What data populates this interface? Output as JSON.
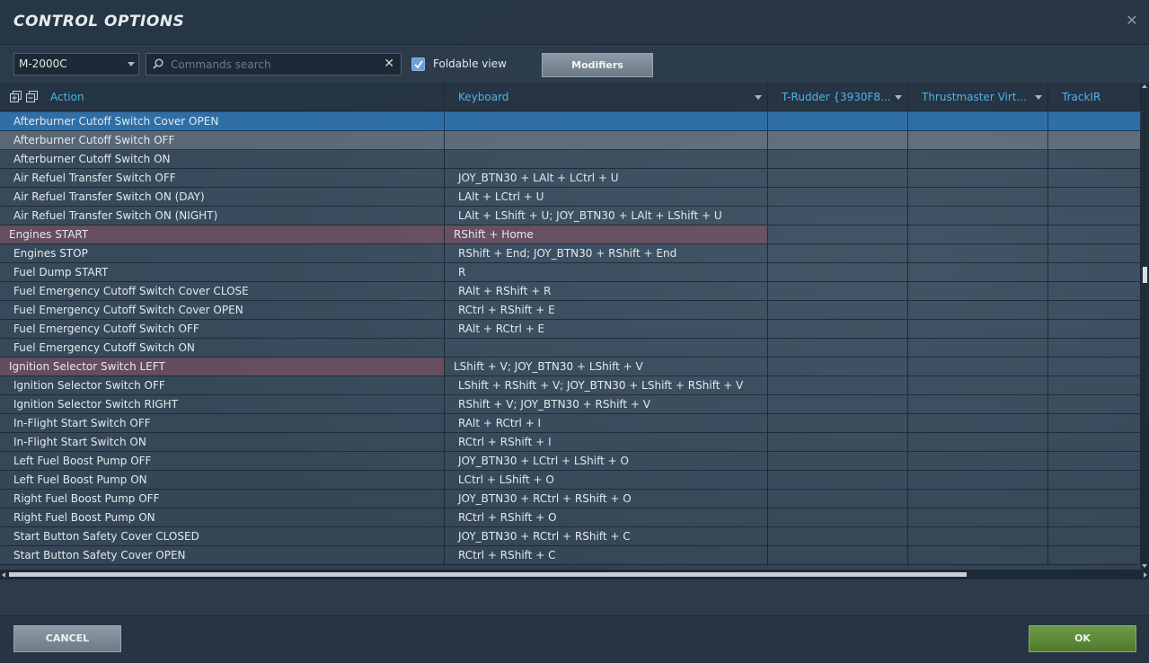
{
  "window": {
    "title": "CONTROL OPTIONS"
  },
  "toolbar": {
    "aircraft": "M-2000C",
    "search_placeholder": "Commands search",
    "foldable_label": "Foldable view",
    "foldable_checked": true,
    "modifiers_label": "Modifiers"
  },
  "columns": {
    "action": "Action",
    "keyboard": "Keyboard",
    "rudder": "T-Rudder {3930F8...",
    "throttle": "Thrustmaster Virt...",
    "trackir": "TrackIR"
  },
  "rows": [
    {
      "action": "Afterburner Cutoff Switch Cover OPEN",
      "keyboard": "",
      "state": "selected"
    },
    {
      "action": "Afterburner Cutoff Switch OFF",
      "keyboard": "",
      "state": "hover"
    },
    {
      "action": "Afterburner Cutoff Switch ON",
      "keyboard": "",
      "state": ""
    },
    {
      "action": "Air Refuel Transfer Switch OFF",
      "keyboard": "JOY_BTN30 + LAlt + LCtrl + U",
      "state": ""
    },
    {
      "action": "Air Refuel Transfer Switch ON (DAY)",
      "keyboard": "LAlt + LCtrl + U",
      "state": ""
    },
    {
      "action": "Air Refuel Transfer Switch ON (NIGHT)",
      "keyboard": "LAlt + LShift + U; JOY_BTN30 + LAlt + LShift + U",
      "state": ""
    },
    {
      "action": "Engines START",
      "keyboard": "RShift + Home",
      "state": "group-conflict"
    },
    {
      "action": "Engines STOP",
      "keyboard": "RShift + End; JOY_BTN30 + RShift + End",
      "state": ""
    },
    {
      "action": "Fuel Dump START",
      "keyboard": "R",
      "state": ""
    },
    {
      "action": "Fuel Emergency Cutoff Switch Cover CLOSE",
      "keyboard": "RAlt + RShift + R",
      "state": ""
    },
    {
      "action": "Fuel Emergency Cutoff Switch Cover OPEN",
      "keyboard": "RCtrl + RShift + E",
      "state": ""
    },
    {
      "action": "Fuel Emergency Cutoff Switch OFF",
      "keyboard": "RAlt + RCtrl + E",
      "state": ""
    },
    {
      "action": "Fuel Emergency Cutoff Switch ON",
      "keyboard": "",
      "state": ""
    },
    {
      "action": "Ignition Selector Switch LEFT",
      "keyboard": "LShift + V; JOY_BTN30 + LShift + V",
      "state": "group-conflict-action"
    },
    {
      "action": "Ignition Selector Switch OFF",
      "keyboard": "LShift + RShift + V; JOY_BTN30 + LShift + RShift + V",
      "state": ""
    },
    {
      "action": "Ignition Selector Switch RIGHT",
      "keyboard": "RShift + V; JOY_BTN30 + RShift + V",
      "state": ""
    },
    {
      "action": "In-Flight Start Switch OFF",
      "keyboard": "RAlt + RCtrl + I",
      "state": ""
    },
    {
      "action": "In-Flight Start Switch ON",
      "keyboard": "RCtrl + RShift + I",
      "state": ""
    },
    {
      "action": "Left Fuel Boost Pump OFF",
      "keyboard": "JOY_BTN30 + LCtrl + LShift + O",
      "state": ""
    },
    {
      "action": "Left Fuel Boost Pump ON",
      "keyboard": "LCtrl + LShift + O",
      "state": ""
    },
    {
      "action": "Right Fuel Boost Pump OFF",
      "keyboard": "JOY_BTN30 + RCtrl + RShift + O",
      "state": ""
    },
    {
      "action": "Right Fuel Boost Pump ON",
      "keyboard": "RCtrl + RShift + O",
      "state": ""
    },
    {
      "action": "Start Button Safety Cover CLOSED",
      "keyboard": "JOY_BTN30 + RCtrl + RShift + C",
      "state": ""
    },
    {
      "action": "Start Button Safety Cover OPEN",
      "keyboard": "RCtrl + RShift + C",
      "state": ""
    }
  ],
  "footer": {
    "cancel_label": "CANCEL",
    "ok_label": "OK"
  },
  "colors": {
    "accent": "#4fb3e8",
    "selected_row": "#2f6fa8",
    "ok_green": "#5b8a3a"
  }
}
